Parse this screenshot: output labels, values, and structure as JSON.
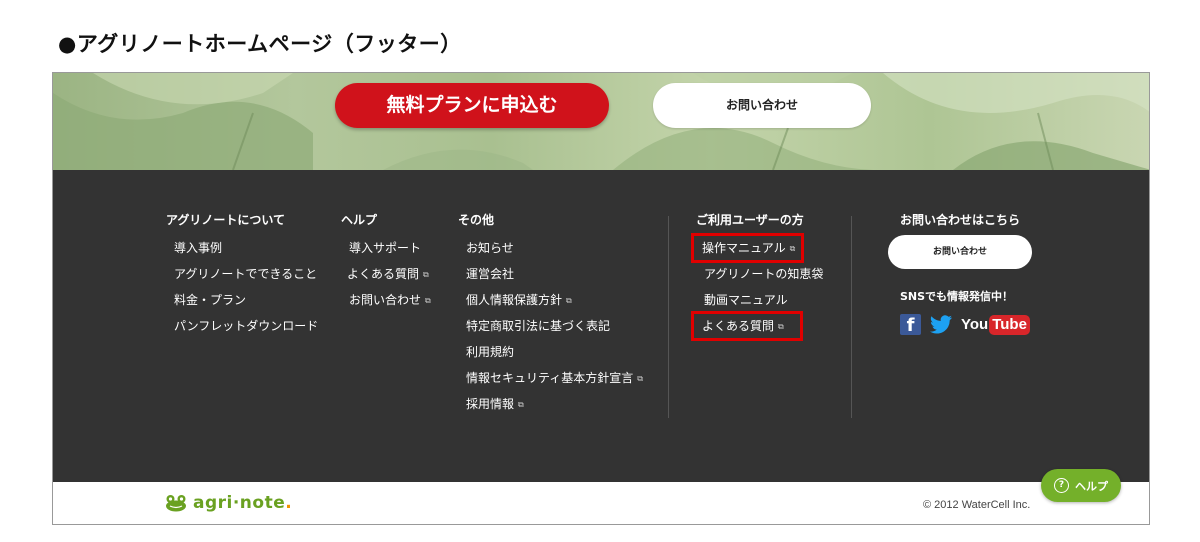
{
  "page_title": "●アグリノートホームページ（フッター）",
  "hero": {
    "primary_cta": "無料プランに申込む",
    "secondary_cta": "お問い合わせ"
  },
  "footer": {
    "columns": [
      {
        "heading": "アグリノートについて",
        "items": [
          {
            "label": "導入事例"
          },
          {
            "label": "アグリノートでできること"
          },
          {
            "label": "料金・プラン"
          },
          {
            "label": "パンフレットダウンロード"
          }
        ]
      },
      {
        "heading": "ヘルプ",
        "items": [
          {
            "label": "導入サポート"
          },
          {
            "label": "よくある質問"
          },
          {
            "label": "お問い合わせ"
          }
        ]
      },
      {
        "heading": "その他",
        "items": [
          {
            "label": "お知らせ"
          },
          {
            "label": "運営会社"
          },
          {
            "label": "個人情報保護方針"
          },
          {
            "label": "特定商取引法に基づく表記"
          },
          {
            "label": "利用規約"
          },
          {
            "label": "情報セキュリティ基本方針宣言"
          },
          {
            "label": "採用情報"
          }
        ]
      },
      {
        "heading": "ご利用ユーザーの方",
        "items": [
          {
            "label": "操作マニュアル"
          },
          {
            "label": "アグリノートの知恵袋"
          },
          {
            "label": "動画マニュアル"
          },
          {
            "label": "よくある質問"
          }
        ]
      }
    ],
    "contact": {
      "heading": "お問い合わせはこちら",
      "button": "お問い合わせ",
      "sns_heading": "SNSでも情報発信中！",
      "youtube_you": "You",
      "youtube_tube": "Tube",
      "facebook_glyph": "f"
    },
    "logo_text": "agri·note",
    "logo_dot": ".",
    "copyright": "© 2012 WaterCell Inc."
  },
  "help_button": "ヘルプ",
  "help_icon_glyph": "?",
  "external_glyph": "⧉",
  "colors": {
    "primary_red": "#d0121b",
    "footer_bg": "#333333",
    "highlight": "#e00000",
    "brand_green": "#6aa121",
    "help_green": "#74b02a",
    "facebook_blue": "#3b5998",
    "twitter_blue": "#1da1f2",
    "youtube_red": "#d8262a"
  }
}
